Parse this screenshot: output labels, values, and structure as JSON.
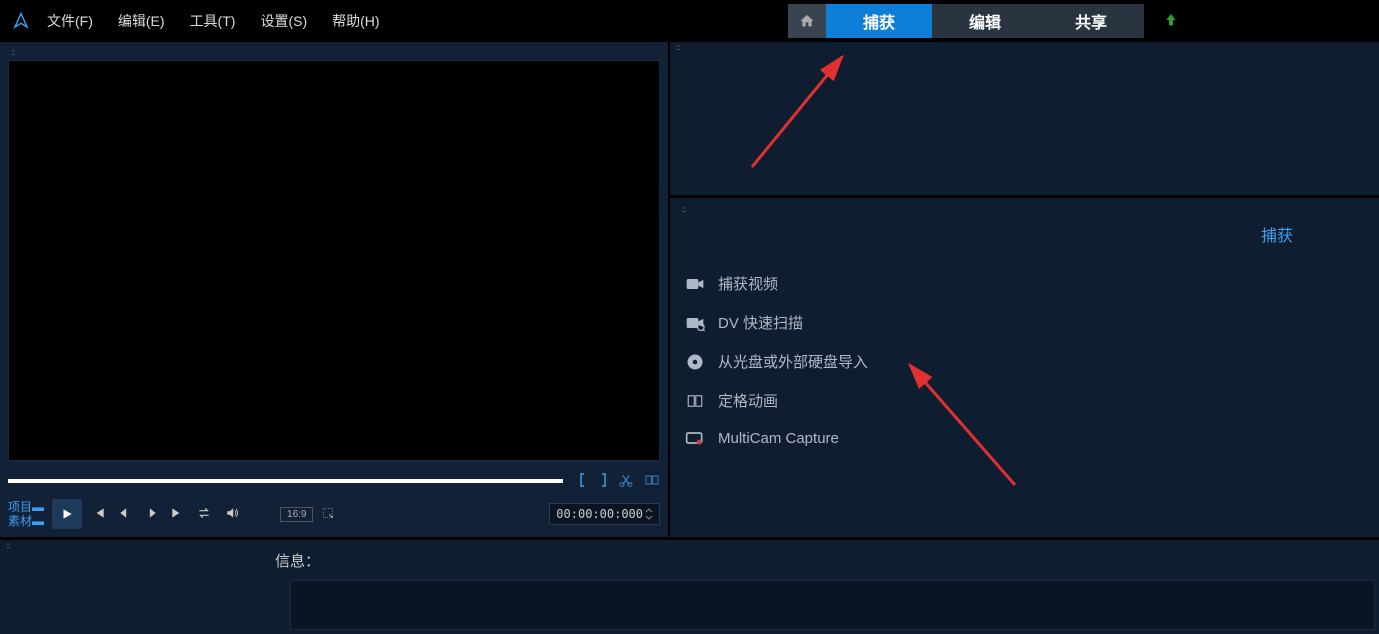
{
  "menu": {
    "file": "文件(F)",
    "edit": "编辑(E)",
    "tools": "工具(T)",
    "settings": "设置(S)",
    "help": "帮助(H)"
  },
  "tabs": {
    "capture": "捕获",
    "edit": "编辑",
    "share": "共享"
  },
  "preview": {
    "project_label": "项目",
    "material_label": "素材",
    "aspect_ratio": "16:9",
    "timecode": "00:00:00:000"
  },
  "capture_panel": {
    "title": "捕获",
    "options": [
      "捕获视频",
      "DV 快速扫描",
      "从光盘或外部硬盘导入",
      "定格动画",
      "MultiCam Capture"
    ]
  },
  "bottom": {
    "info_label": "信息："
  }
}
